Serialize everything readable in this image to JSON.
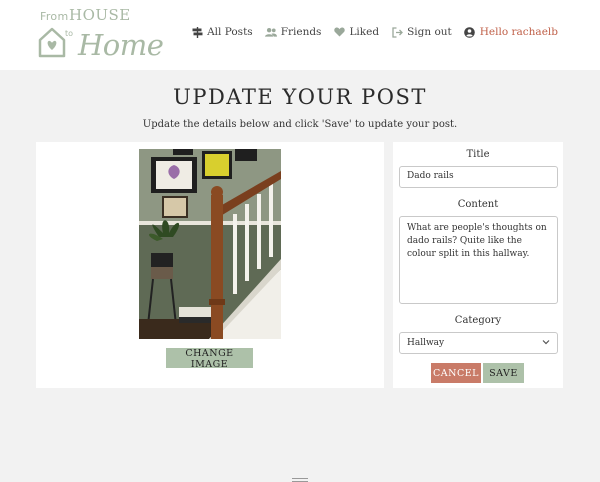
{
  "brand": {
    "from": "From",
    "house": "HOUSE",
    "to": "to",
    "home": "Home"
  },
  "nav": {
    "all_posts": "All Posts",
    "friends": "Friends",
    "liked": "Liked",
    "sign_out": "Sign out",
    "user": "Hello rachaelb"
  },
  "page": {
    "title": "UPDATE YOUR POST",
    "subtitle": "Update the details below and click 'Save' to update your post."
  },
  "image_panel": {
    "change_label": "CHANGE IMAGE"
  },
  "form": {
    "title_label": "Title",
    "title_value": "Dado rails",
    "content_label": "Content",
    "content_value": "What are people's thoughts on dado rails? Quite like the colour split in this hallway.",
    "category_label": "Category",
    "category_value": "Hallway",
    "cancel_label": "CANCEL",
    "save_label": "SAVE"
  },
  "colors": {
    "accent_green": "#adc1a9",
    "accent_red": "#c97b68",
    "user_link": "#c0614a"
  }
}
